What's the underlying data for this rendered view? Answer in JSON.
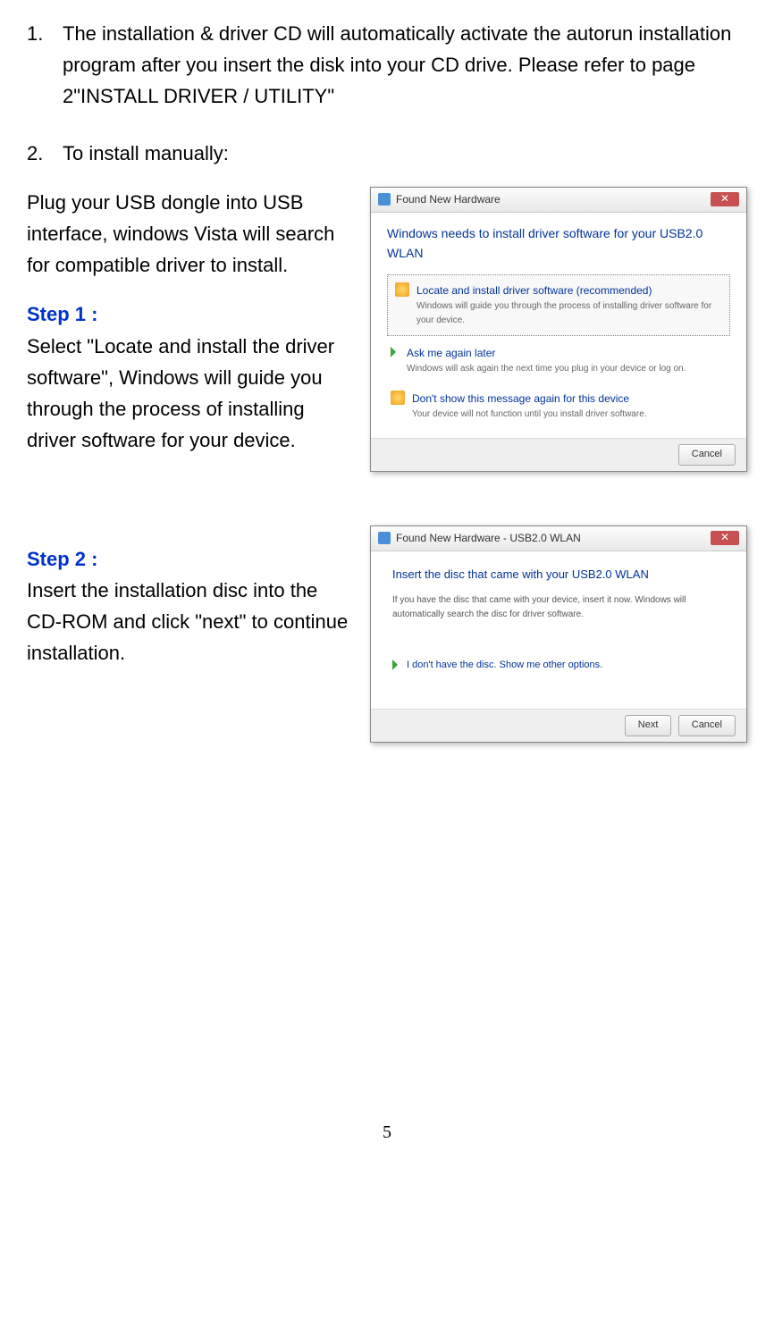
{
  "items": [
    {
      "num": "1.",
      "text": "The installation & driver CD will automatically activate the autorun installation program after you insert the disk into your CD drive. Please refer to page 2\"INSTALL DRIVER / UTILITY\""
    },
    {
      "num": "2.",
      "text": "To install manually:"
    }
  ],
  "intro": "Plug your USB dongle into USB interface, windows Vista will search for compatible driver to install.",
  "step1": {
    "label": "Step 1 :",
    "text": "Select \"Locate and install the driver software\", Windows will guide you through the process of installing driver software for your device."
  },
  "step2": {
    "label": "Step 2 :",
    "text": "Insert the installation disc into the CD-ROM and click \"next\" to continue installation."
  },
  "dialog1": {
    "title": "Found New Hardware",
    "heading": "Windows needs to install driver software for your USB2.0 WLAN",
    "opt1": {
      "title": "Locate and install driver software (recommended)",
      "desc": "Windows will guide you through the process of installing driver software for your device."
    },
    "opt2": {
      "title": "Ask me again later",
      "desc": "Windows will ask again the next time you plug in your device or log on."
    },
    "opt3": {
      "title": "Don't show this message again for this device",
      "desc": "Your device will not function until you install driver software."
    },
    "cancel": "Cancel"
  },
  "dialog2": {
    "title": "Found New Hardware - USB2.0 WLAN",
    "instruct": "Insert the disc that came with your USB2.0 WLAN",
    "sub": "If you have the disc that came with your device, insert it now. Windows will automatically search the disc for driver software.",
    "link": "I don't have the disc. Show me other options.",
    "next": "Next",
    "cancel": "Cancel"
  },
  "page_num": "5"
}
